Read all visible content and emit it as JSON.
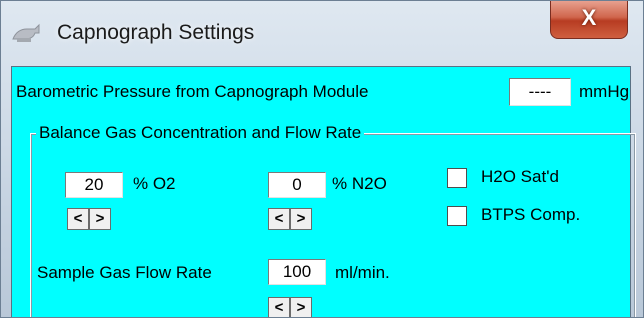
{
  "window": {
    "title": "Capnograph Settings",
    "close_label": "X",
    "icon": "capnograph-app-icon"
  },
  "barometric": {
    "label": "Barometric Pressure from Capnograph Module",
    "value": "----",
    "unit": "mmHg"
  },
  "group": {
    "title": "Balance Gas Concentration and Flow Rate",
    "o2": {
      "value": "20",
      "unit": "% O2"
    },
    "n2o": {
      "value": "0",
      "unit": "% N2O"
    },
    "h2o_sat": {
      "label": "H2O Sat'd",
      "checked": false
    },
    "btps": {
      "label": "BTPS Comp.",
      "checked": false
    },
    "flow": {
      "label": "Sample Gas Flow Rate",
      "value": "100",
      "unit": "ml/min."
    },
    "arrow_left": "<",
    "arrow_right": ">"
  },
  "colors": {
    "client_bg": "#00ffff",
    "close_red": "#c8452a"
  }
}
